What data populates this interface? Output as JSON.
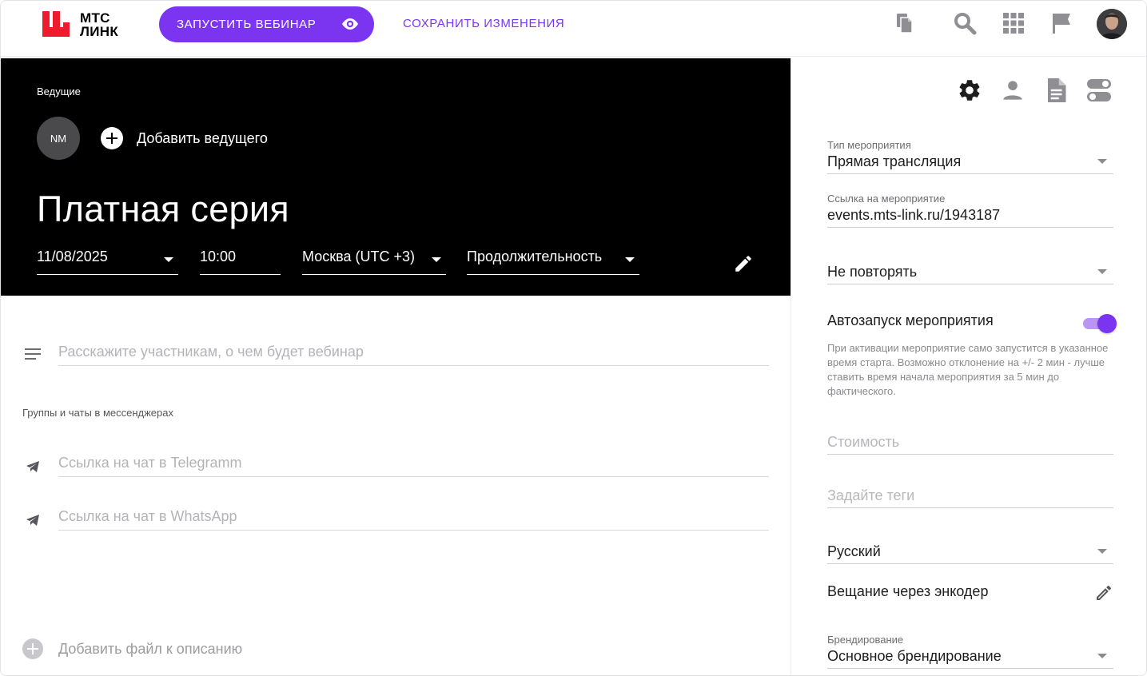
{
  "header": {
    "logo_line1": "МТС",
    "logo_line2": "ЛИНК",
    "launch_button": "ЗАПУСТИТЬ ВЕБИНАР",
    "save_button": "СОХРАНИТЬ ИЗМЕНЕНИЯ",
    "icons": [
      "copy-icon",
      "search-icon",
      "apps-grid-icon",
      "flag-icon",
      "user-avatar"
    ],
    "accent": "#7b35f0"
  },
  "hero": {
    "hosts_label": "Ведущие",
    "host_initials": "NM",
    "add_host": "Добавить ведущего",
    "title": "Платная серия",
    "date": "11/08/2025",
    "time": "10:00",
    "timezone": "Москва (UTC +3)",
    "duration": "Продолжительность"
  },
  "content": {
    "description_placeholder": "Расскажите участникам, о чем будет вебинар",
    "groups_label": "Группы и чаты в мессенджерах",
    "telegram_placeholder": "Ссылка на чат в Telegramm",
    "whatsapp_placeholder": "Ссылка на чат в WhatsApp",
    "add_file": "Добавить файл к описанию"
  },
  "settings": {
    "tabs": [
      "settings-icon",
      "person-icon",
      "document-icon",
      "toggles-icon"
    ],
    "event_type_label": "Тип мероприятия",
    "event_type_value": "Прямая трансляция",
    "event_link_label": "Ссылка на мероприятие",
    "event_link_value": "events.mts-link.ru/1943187",
    "repeat_value": "Не повторять",
    "autostart_label": "Автозапуск мероприятия",
    "autostart_enabled": true,
    "autostart_help": "При активации мероприятие само запустится в указанное время старта. Возможно отклонение на +/- 2 мин - лучше ставить время начала мероприятия за 5 мин до фактического.",
    "price_placeholder": "Стоимость",
    "tags_placeholder": "Задайте теги",
    "language_value": "Русский",
    "encoder_label": "Вещание через энкодер",
    "branding_label": "Брендирование",
    "branding_value": "Основное брендирование"
  }
}
